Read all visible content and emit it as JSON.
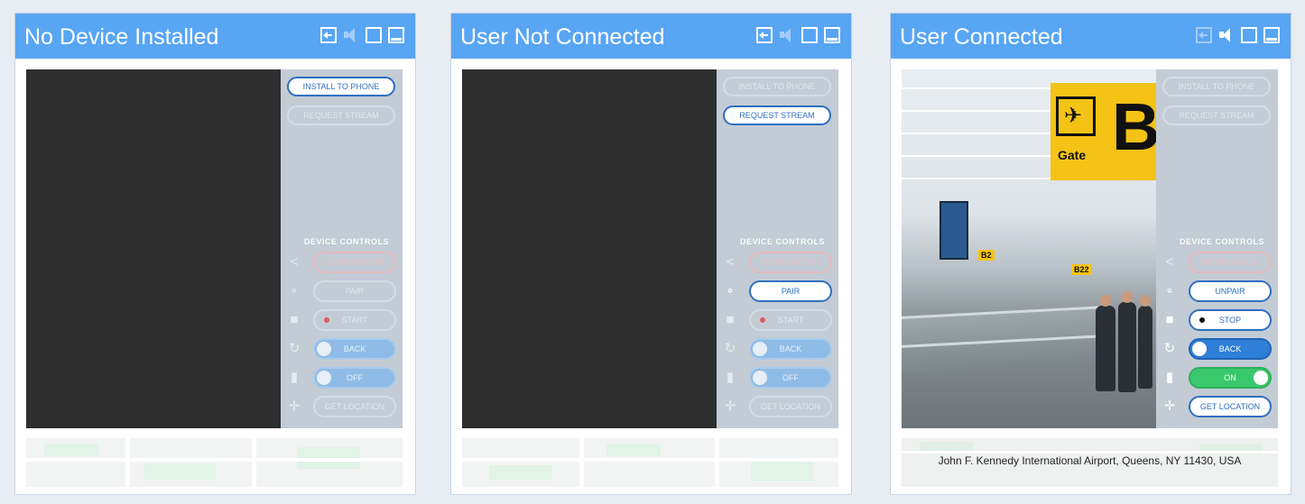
{
  "panels": [
    {
      "title": "No Device Installed",
      "header_icons": [
        "exit-icon",
        "speaker-icon",
        "fullscreen-icon",
        "minimize-icon"
      ],
      "video": "empty",
      "buttons": {
        "install": "INSTALL TO PHONE",
        "request": "REQUEST STREAM"
      },
      "device_controls_label": "DEVICE CONTROLS",
      "controls": {
        "notification": "NOTIFICATION",
        "pair": "PAIR",
        "record": "START",
        "camera": "BACK",
        "mic": "OFF",
        "location": "GET LOCATION"
      },
      "location_text": ""
    },
    {
      "title": "User Not Connected",
      "header_icons": [
        "exit-icon",
        "speaker-icon",
        "fullscreen-icon",
        "minimize-icon"
      ],
      "video": "empty",
      "buttons": {
        "install": "INSTALL TO PHONE",
        "request": "REQUEST STREAM"
      },
      "device_controls_label": "DEVICE CONTROLS",
      "controls": {
        "notification": "NOTIFICATION",
        "pair": "PAIR",
        "record": "START",
        "camera": "BACK",
        "mic": "OFF",
        "location": "GET LOCATION"
      },
      "location_text": ""
    },
    {
      "title": "User Connected",
      "header_icons": [
        "exit-icon",
        "speaker-icon",
        "fullscreen-icon",
        "minimize-icon"
      ],
      "video": "airport-stream",
      "photo_signs": {
        "gate_word": "Gate",
        "gate_letter": "B",
        "sign_b2": "B2",
        "sign_b22": "B22"
      },
      "buttons": {
        "install": "INSTALL TO PHONE",
        "request": "REQUEST STREAM"
      },
      "device_controls_label": "DEVICE CONTROLS",
      "controls": {
        "notification": "NOTIFICATION",
        "pair": "UNPAIR",
        "record": "STOP",
        "camera": "BACK",
        "mic": "ON",
        "location": "GET LOCATION"
      },
      "location_text": "John F. Kennedy International Airport, Queens, NY 11430, USA"
    }
  ],
  "colors": {
    "header": "#58a5f4",
    "video_bg": "#2e2e2e",
    "sidebar_bg": "#c3ccd5",
    "active_outline": "#2f6fc0",
    "toggle_blue": "#2f7fd8",
    "toggle_green": "#39c96c",
    "gate_sign": "#f4c316"
  }
}
